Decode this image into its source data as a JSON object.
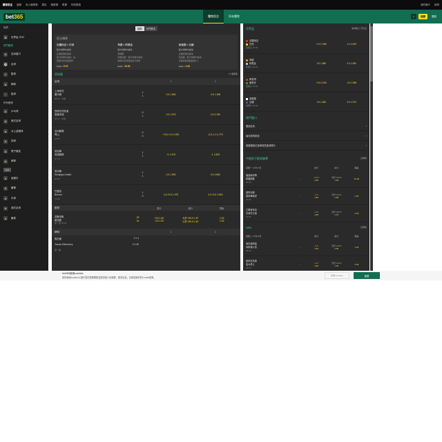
{
  "topnav": {
    "items": [
      "體育投注",
      "遊戲",
      "真人娛樂場",
      "撲克",
      "娛樂場",
      "賓果",
      "特別優惠"
    ],
    "active_index": 0,
    "right": [
      "我的帳戶",
      "說明"
    ]
  },
  "header": {
    "logo_main": "bet",
    "logo_accent": "365",
    "tabs": [
      "體育投注",
      "所有體育"
    ],
    "join": "註冊",
    "login": "登錄"
  },
  "sidebar": {
    "heading": "推薦",
    "items": [
      {
        "label": "世界盃 2022",
        "icon": "trophy-icon"
      },
      {
        "label": "亞洲盤口",
        "icon": "ball-icon"
      },
      {
        "label": "足球",
        "icon": "soccer-icon"
      },
      {
        "label": "籃球",
        "icon": "basketball-icon"
      },
      {
        "label": "網球",
        "icon": "tennis-icon"
      },
      {
        "label": "板球",
        "icon": "cricket-icon"
      },
      {
        "label": "乒乓球",
        "icon": "pingpong-icon"
      },
      {
        "label": "美式足球",
        "icon": "football-icon"
      },
      {
        "label": "冰上曲棍球",
        "icon": "hockey-icon"
      },
      {
        "label": "排球",
        "icon": "volleyball-icon"
      },
      {
        "label": "電子競技",
        "icon": "esports-icon"
      },
      {
        "label": "拳擊",
        "icon": "boxing-icon"
      },
      {
        "label": "高爾夫",
        "icon": "golf-icon"
      },
      {
        "label": "賽車",
        "icon": "racing-icon"
      },
      {
        "label": "手球",
        "icon": "handball-icon"
      },
      {
        "label": "澳式足球",
        "icon": "afl-icon"
      }
    ],
    "section_popular": "熱門體育",
    "section_az": "所有體育",
    "tag": "A-Z",
    "bottom_items": [
      {
        "label": "賽馬",
        "icon": "horse-icon"
      }
    ]
  },
  "page_tabs": [
    "推薦",
    "熱門賽事"
  ],
  "bet_builder": {
    "title": "投注構建",
    "cols": [
      {
        "title": "克羅地亞 v 巴西",
        "sub": "雙方球隊均進球",
        "legs": [
          "比賽結果和進球",
          "雙方球隊均進球：是",
          "兩隊均有球員黃牌"
        ],
        "odds_old": "5.00",
        "odds_new": "5.75"
      },
      {
        "title": "荷蘭 v 阿根廷",
        "sub": "雙方球隊均進球",
        "legs": [
          "荷蘭勝",
          "阿根廷勝：雙方球隊均進球",
          "兩隊均有球員被出示黃牌"
        ],
        "odds_old": "9.00",
        "odds_new": "10.00"
      },
      {
        "title": "英格蘭 v 法國",
        "sub": "雙方球隊均進球",
        "legs": [
          "比賽結果和進球",
          "英格蘭：雙方球隊均進球",
          "比賽總角球數超過9.5"
        ],
        "odds_old": "3.75",
        "odds_new": "4.33"
      }
    ]
  },
  "in_play": {
    "title": "滾球盤",
    "count": "75 個賽事"
  },
  "soccer": {
    "title": "足球",
    "col1": "1",
    "col2": "2",
    "rows": [
      {
        "t1": "上海申花",
        "t2": "廣州隊",
        "s1": "1",
        "s2": "1",
        "meta": "88:00 · 半場",
        "o1": "0.0 1.950",
        "o2": "-0.0 1.900"
      },
      {
        "t1": "西悉尼流浪者",
        "t2": "墨爾本城",
        "s1": "0",
        "s2": "1",
        "meta": "55:10 · 半場",
        "o1": "0.0 1.975",
        "o2": "0.0 2.150"
      },
      {
        "t1": "亞洲聯隊",
        "t2": "青山",
        "s1": "0",
        "s2": "0",
        "meta": "43:50",
        "o1": "+0.5,+1.0 2.025",
        "o2": "-0.5,-1.0 1.775"
      },
      {
        "t1": "曼谷聯",
        "t2": "清邁聯隊",
        "s1": "1",
        "s2": "1",
        "meta": "67:10",
        "o1": "+1 1.975",
        "o2": "-1 1.825"
      },
      {
        "t1": "泗水聯",
        "t2": "Sriwijaya United",
        "s1": "1",
        "s2": "1",
        "meta": "82:05",
        "o1": "0.0 1.950",
        "o2": "0.0 1.850"
      },
      {
        "t1": "巴厘島",
        "t2": "Borneo",
        "s1": "1",
        "s2": "0",
        "meta": "71:08",
        "o1": "0.0,+0.5 1.975",
        "o2": "0.0,+0.5 1.825"
      }
    ]
  },
  "basketball": {
    "title": "籃球",
    "cols": [
      "讓分",
      "總分",
      "獨贏"
    ],
    "row": {
      "t1": "墨爾本聯",
      "t2": "新西蘭",
      "s1": "29",
      "s2": "24",
      "meta": "第一節 05:00",
      "spread1": "+3.5 1.90",
      "total1": "大於 190.5 1.87",
      "ml1": "2.30",
      "spread2": "-3.5 1.90",
      "total2": "小於 190.5 1.82",
      "ml2": "1.62"
    }
  },
  "tennis": {
    "title": "網球",
    "col1": "1",
    "col2": "2",
    "rows": [
      {
        "t": "馬杜爾",
        "s": "0 1 4"
      },
      {
        "t": "Tomas Etcheverry",
        "s": "0 2 40"
      }
    ],
    "meta": "第一盤"
  },
  "world_cup": {
    "title": "世界盃",
    "more": "進球盤口 已售出",
    "rows": [
      {
        "t1": "克羅地亞",
        "t2": "巴西",
        "meta": "星期五 23:00",
        "o1": "+1.0 1.980",
        "o2": "-1.0 1.870"
      },
      {
        "t1": "荷蘭",
        "t2": "阿根廷",
        "meta": "星期六 03:00",
        "o1": "0.0 1.880",
        "o2": "0.0 1.980"
      },
      {
        "t1": "摩洛哥",
        "t2": "葡萄牙",
        "meta": "星期六 23:00",
        "o1": "+0.5 2.000",
        "o2": "-0.5 1.850"
      },
      {
        "t1": "英格蘭",
        "t2": "法國",
        "meta": "星期日 03:00",
        "o1": "0.0 1.830",
        "o2": "0.0 1.970"
      }
    ]
  },
  "popular": {
    "title": "熱門盤口",
    "items": [
      "雙倍紅利",
      "最佳球員助攻",
      "英格蘭首位進球球員進球得分"
    ]
  },
  "cba": {
    "title": "中國男子籃球聯賽",
    "more": "比賽前",
    "date": "星期一 12月19日",
    "cols": [
      "讓分",
      "總分",
      "獨贏"
    ],
    "rows": [
      {
        "t1": "福建鱘潯興",
        "t2": "新疆廣匯",
        "meta": "19:35",
        "c1a": "+22.5",
        "c1b": "1.85",
        "c2a": "高於 184.5",
        "c2b": "1.83",
        "c3": "10.00"
      },
      {
        "t1": "遼寧本鋼",
        "t2": "廣東華南虎",
        "meta": "19:35",
        "c1a": "-4.5",
        "c1b": "1.85",
        "c2a": "高於 211.5",
        "c2b": "1.85",
        "c3": "1.65"
      },
      {
        "t1": "江蘇肯帝亞",
        "t2": "天津先行者",
        "meta": "19:35",
        "c1a": "+4.5",
        "c1b": "1.85",
        "c2a": "高於 209.5",
        "c2b": "1.87",
        "c3": "2.65"
      }
    ]
  },
  "nba": {
    "title": "NBA",
    "more": "比賽前",
    "date": "星期二 12月20日",
    "rows": [
      {
        "t1": "洛杉磯快船",
        "t2": "休斯頓火箭",
        "meta": "08:00",
        "c1a": "-9.5",
        "c1b": "1.83",
        "c2a": "高於 220.5",
        "c2b": "1.90",
        "c3": "1.25"
      },
      {
        "t1": "紐約尼克斯",
        "t2": "金州勇士",
        "meta": "08:00",
        "c1a": "+2.5",
        "c1b": "1.90",
        "c2a": "高於 234.5",
        "c2b": "1.90",
        "c3": "2.05"
      }
    ]
  },
  "cookie": {
    "title": "bet365使用cookies",
    "text": "我們使用cookies以提升您的瀏覽體驗並提供個人化服務，更多信息，請參閱我們的Cookie政策。",
    "manage": "管理 Cookies",
    "accept": "接受"
  }
}
